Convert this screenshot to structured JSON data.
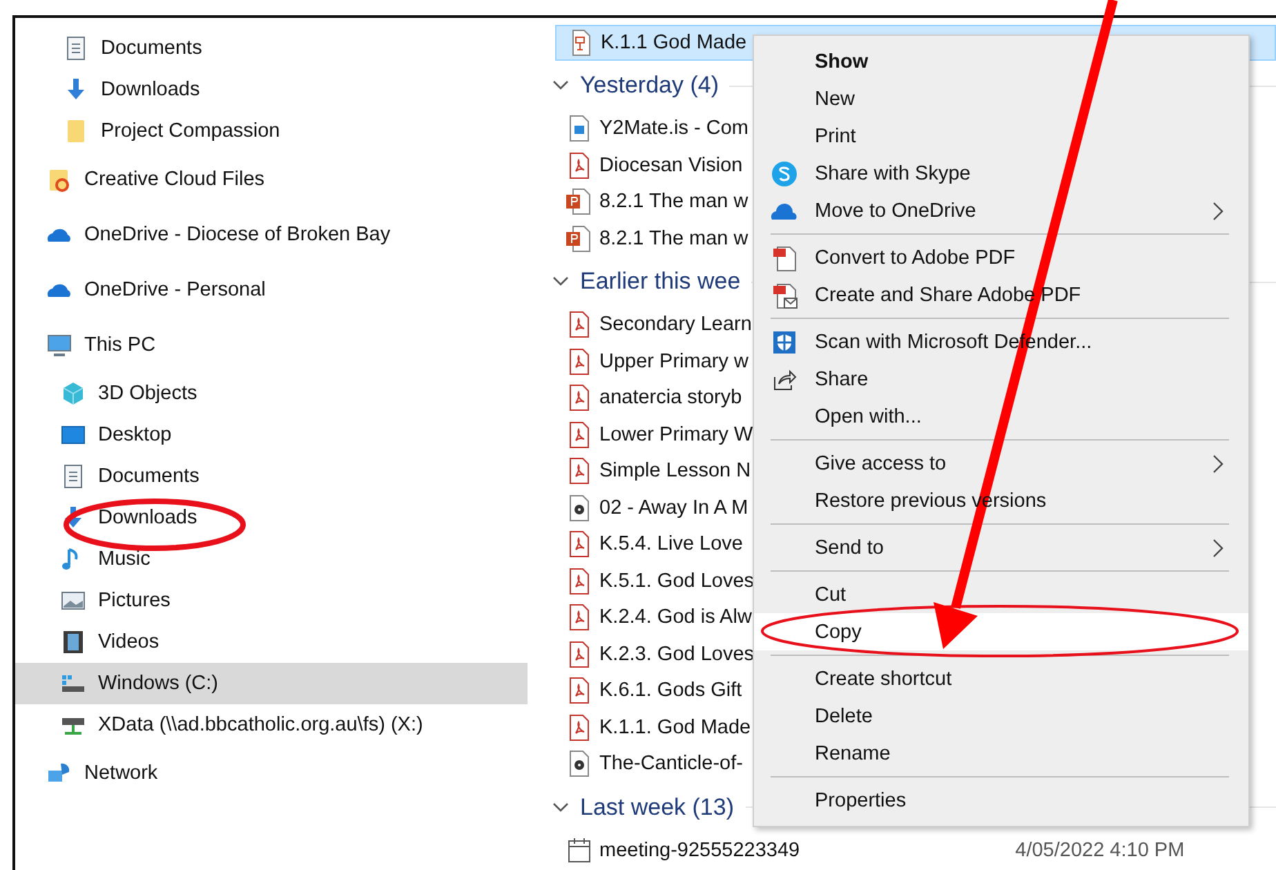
{
  "navigation": {
    "quick_access_items": [
      {
        "label": "Documents",
        "kind": "documents",
        "selected": false
      },
      {
        "label": "Downloads",
        "kind": "downloads",
        "selected": false
      },
      {
        "label": "Project Compassion",
        "kind": "folder",
        "selected": false
      }
    ],
    "tree": [
      {
        "label": "Creative Cloud Files",
        "kind": "creative-cloud",
        "selected": false
      },
      {
        "label": "OneDrive - Diocese of Broken Bay",
        "kind": "onedrive",
        "selected": false
      },
      {
        "label": "OneDrive - Personal",
        "kind": "onedrive",
        "selected": false
      },
      {
        "label": "This PC",
        "kind": "pc",
        "selected": false,
        "children": [
          {
            "label": "3D Objects",
            "kind": "objects3d",
            "selected": false
          },
          {
            "label": "Desktop",
            "kind": "desktop",
            "selected": false
          },
          {
            "label": "Documents",
            "kind": "documents",
            "selected": false
          },
          {
            "label": "Downloads",
            "kind": "downloads",
            "selected": false
          },
          {
            "label": "Music",
            "kind": "music",
            "selected": false
          },
          {
            "label": "Pictures",
            "kind": "pictures",
            "selected": false
          },
          {
            "label": "Videos",
            "kind": "videos",
            "selected": false
          },
          {
            "label": "Windows (C:)",
            "kind": "drive",
            "selected": true
          },
          {
            "label": "XData (\\\\ad.bbcatholic.org.au\\fs) (X:)",
            "kind": "network-drive",
            "selected": false
          }
        ]
      },
      {
        "label": "Network",
        "kind": "network",
        "selected": false
      }
    ]
  },
  "file_list": {
    "groups": [
      {
        "files": [
          {
            "name": "K.1.1 God Made",
            "kind": "presentation",
            "selected": true
          }
        ]
      },
      {
        "header": "Yesterday (4)",
        "files": [
          {
            "name": "Y2Mate.is - Com",
            "kind": "video",
            "selected": false
          },
          {
            "name": "Diocesan Vision",
            "kind": "pdf",
            "selected": false
          },
          {
            "name": "8.2.1 The man w",
            "kind": "ppt",
            "selected": false
          },
          {
            "name": "8.2.1 The man w",
            "kind": "ppt",
            "selected": false
          }
        ]
      },
      {
        "header": "Earlier this wee",
        "files": [
          {
            "name": "Secondary Learn",
            "kind": "pdf",
            "selected": false
          },
          {
            "name": "Upper Primary w",
            "kind": "pdf",
            "selected": false
          },
          {
            "name": "anatercia storyb",
            "kind": "pdf",
            "selected": false
          },
          {
            "name": "Lower Primary W",
            "kind": "pdf",
            "selected": false
          },
          {
            "name": "Simple Lesson N",
            "kind": "pdf",
            "selected": false
          },
          {
            "name": "02 - Away In A M",
            "kind": "audio",
            "selected": false
          },
          {
            "name": "K.5.4. Live Love",
            "kind": "pdf",
            "selected": false
          },
          {
            "name": "K.5.1. God Loves",
            "kind": "pdf",
            "selected": false
          },
          {
            "name": "K.2.4. God is Alw",
            "kind": "pdf",
            "selected": false
          },
          {
            "name": "K.2.3. God Loves",
            "kind": "pdf",
            "selected": false
          },
          {
            "name": "K.6.1. Gods Gift",
            "kind": "pdf",
            "selected": false
          },
          {
            "name": "K.1.1. God Made",
            "kind": "pdf",
            "selected": false
          },
          {
            "name": "The-Canticle-of-",
            "kind": "audio",
            "selected": false
          }
        ]
      },
      {
        "header": "Last week (13)",
        "files": [
          {
            "name": "meeting-92555223349",
            "kind": "calendar",
            "selected": false,
            "modified": "4/05/2022 4:10 PM"
          }
        ]
      }
    ]
  },
  "context_menu": {
    "sections": [
      [
        {
          "label": "Show",
          "kind": "plain",
          "default": true,
          "submenu": false,
          "selected": false
        },
        {
          "label": "New",
          "kind": "plain",
          "default": false,
          "submenu": false,
          "selected": false
        },
        {
          "label": "Print",
          "kind": "plain",
          "default": false,
          "submenu": false,
          "selected": false
        },
        {
          "label": "Share with Skype",
          "kind": "skype",
          "default": false,
          "submenu": false,
          "selected": false
        },
        {
          "label": "Move to OneDrive",
          "kind": "onedrive",
          "default": false,
          "submenu": true,
          "selected": false
        }
      ],
      [
        {
          "label": "Convert to Adobe PDF",
          "kind": "pdf",
          "default": false,
          "submenu": false,
          "selected": false
        },
        {
          "label": "Create and Share Adobe PDF",
          "kind": "pdf-share",
          "default": false,
          "submenu": false,
          "selected": false
        }
      ],
      [
        {
          "label": "Scan with Microsoft Defender...",
          "kind": "defender",
          "default": false,
          "submenu": false,
          "selected": false
        },
        {
          "label": "Share",
          "kind": "share",
          "default": false,
          "submenu": false,
          "selected": false
        },
        {
          "label": "Open with...",
          "kind": "plain",
          "default": false,
          "submenu": false,
          "selected": false
        }
      ],
      [
        {
          "label": "Give access to",
          "kind": "plain",
          "default": false,
          "submenu": true,
          "selected": false
        },
        {
          "label": "Restore previous versions",
          "kind": "plain",
          "default": false,
          "submenu": false,
          "selected": false
        }
      ],
      [
        {
          "label": "Send to",
          "kind": "plain",
          "default": false,
          "submenu": true,
          "selected": false
        }
      ],
      [
        {
          "label": "Cut",
          "kind": "plain",
          "default": false,
          "submenu": false,
          "selected": false
        },
        {
          "label": "Copy",
          "kind": "plain",
          "default": false,
          "submenu": false,
          "selected": true
        }
      ],
      [
        {
          "label": "Create shortcut",
          "kind": "plain",
          "default": false,
          "submenu": false,
          "selected": false
        },
        {
          "label": "Delete",
          "kind": "plain",
          "default": false,
          "submenu": false,
          "selected": false
        },
        {
          "label": "Rename",
          "kind": "plain",
          "default": false,
          "submenu": false,
          "selected": false
        }
      ],
      [
        {
          "label": "Properties",
          "kind": "plain",
          "default": false,
          "submenu": false,
          "selected": false
        }
      ]
    ]
  }
}
